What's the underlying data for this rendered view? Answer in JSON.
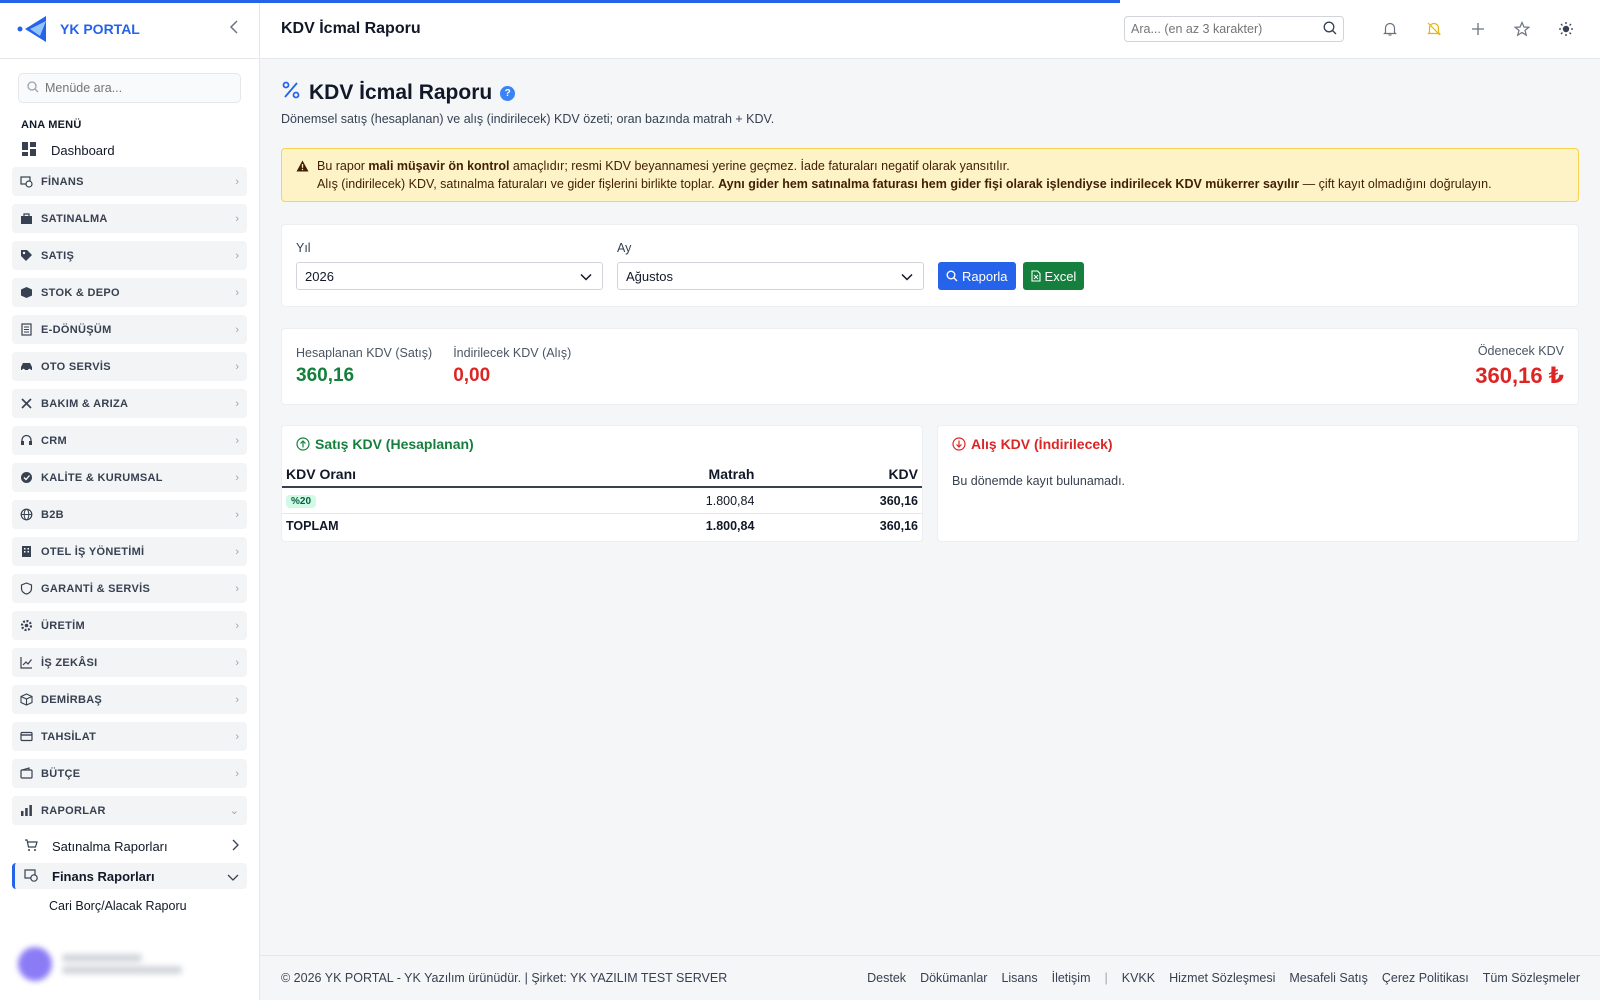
{
  "sidebar": {
    "brand": "YK PORTAL",
    "search_placeholder": "Menüde ara...",
    "section": "ANA MENÜ",
    "dashboard": "Dashboard",
    "items": [
      {
        "label": "FİNANS",
        "icon": "finance-icon"
      },
      {
        "label": "SATINALMA",
        "icon": "purchase-icon"
      },
      {
        "label": "SATIŞ",
        "icon": "tag-icon"
      },
      {
        "label": "STOK & DEPO",
        "icon": "box-icon"
      },
      {
        "label": "E-DÖNÜŞÜM",
        "icon": "document-icon"
      },
      {
        "label": "OTO SERVİS",
        "icon": "car-icon"
      },
      {
        "label": "BAKIM & ARIZA",
        "icon": "tools-icon"
      },
      {
        "label": "CRM",
        "icon": "headset-icon"
      },
      {
        "label": "KALİTE & KURUMSAL",
        "icon": "quality-icon"
      },
      {
        "label": "B2B",
        "icon": "globe-icon"
      },
      {
        "label": "OTEL İŞ YÖNETİMİ",
        "icon": "building-icon"
      },
      {
        "label": "GARANTİ & SERVİS",
        "icon": "shield-icon"
      },
      {
        "label": "ÜRETİM",
        "icon": "gear-icon"
      },
      {
        "label": "İŞ ZEKÂSI",
        "icon": "chart-line-icon"
      },
      {
        "label": "DEMİRBAŞ",
        "icon": "cube-icon"
      },
      {
        "label": "TAHSİLAT",
        "icon": "card-icon"
      },
      {
        "label": "BÜTÇE",
        "icon": "wallet-icon"
      },
      {
        "label": "RAPORLAR",
        "icon": "bar-chart-icon"
      }
    ],
    "reports_sub": {
      "purchase_reports": "Satınalma Raporları",
      "finance_reports": "Finans Raporları",
      "cari_report": "Cari Borç/Alacak Raporu"
    }
  },
  "header": {
    "title": "KDV İcmal Raporu",
    "search_placeholder": "Ara... (en az 3 karakter)"
  },
  "main": {
    "title": "KDV İcmal Raporu",
    "help": "?",
    "description": "Dönemsel satış (hesaplanan) ve alış (indirilecek) KDV özeti; oran bazında matrah + KDV.",
    "alert": {
      "l1_a": "Bu rapor ",
      "l1_b": "mali müşavir ön kontrol",
      "l1_c": " amaçlıdır; resmi KDV beyannamesi yerine geçmez. İade faturaları negatif olarak yansıtılır.",
      "l2_a": "Alış (indirilecek) KDV, satınalma faturaları ve gider fişlerini birlikte toplar. ",
      "l2_b": "Aynı gider hem satınalma faturası hem gider fişi olarak işlendiyse indirilecek KDV mükerrer sayılır",
      "l2_c": " — çift kayıt olmadığını doğrulayın."
    },
    "filters": {
      "year_label": "Yıl",
      "year_value": "2026",
      "month_label": "Ay",
      "month_value": "Ağustos",
      "report_button": "Raporla",
      "excel_button": "Excel"
    },
    "summary": {
      "calc_label": "Hesaplanan KDV (Satış)",
      "calc_value": "360,16",
      "deduct_label": "İndirilecek KDV (Alış)",
      "deduct_value": "0,00",
      "payable_label": "Ödenecek KDV",
      "payable_value": "360,16 ₺"
    },
    "sales": {
      "title": "Satış KDV (Hesaplanan)",
      "headers": [
        "KDV Oranı",
        "Matrah",
        "KDV"
      ],
      "rows": [
        {
          "rate": "%20",
          "base": "1.800,84",
          "vat": "360,16"
        }
      ],
      "total": {
        "label": "TOPLAM",
        "base": "1.800,84",
        "vat": "360,16"
      }
    },
    "purchase": {
      "title": "Alış KDV (İndirilecek)",
      "empty": "Bu dönemde kayıt bulunamadı."
    }
  },
  "footer": {
    "copyright": "© 2026 YK PORTAL - YK Yazılım ürünüdür. | Şirket: YK YAZILIM TEST SERVER",
    "links_a": [
      "Destek",
      "Dökümanlar",
      "Lisans",
      "İletişim"
    ],
    "separator": "|",
    "links_b": [
      "KVKK",
      "Hizmet Sözleşmesi",
      "Mesafeli Satış",
      "Çerez Politikası",
      "Tüm Sözleşmeler"
    ]
  },
  "colors": {
    "accent": "#2563eb",
    "positive": "#15803d",
    "negative": "#dc2626",
    "warning_bg": "#fef3c7"
  }
}
